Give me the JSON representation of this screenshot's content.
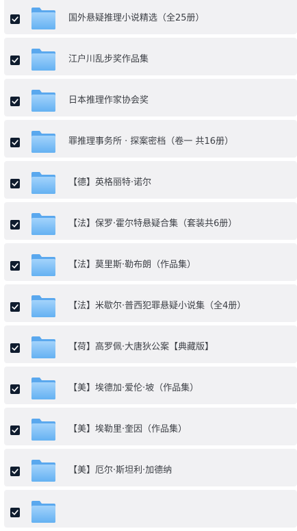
{
  "file_list": {
    "items": [
      {
        "name": "国外悬疑推理小说精选（全25册）",
        "checked": true,
        "icon": "folder-icon"
      },
      {
        "name": "江户川乱步奖作品集",
        "checked": true,
        "icon": "folder-icon"
      },
      {
        "name": "日本推理作家协会奖",
        "checked": true,
        "icon": "folder-icon"
      },
      {
        "name": "罪推理事务所 · 探案密档（卷一 共16册）",
        "checked": true,
        "icon": "folder-icon"
      },
      {
        "name": "【德】英格丽特·诺尔",
        "checked": true,
        "icon": "folder-icon"
      },
      {
        "name": "【法】保罗·霍尔特悬疑合集（套装共6册）",
        "checked": true,
        "icon": "folder-icon"
      },
      {
        "name": "【法】莫里斯·勒布朗（作品集）",
        "checked": true,
        "icon": "folder-icon"
      },
      {
        "name": "【法】米歇尔·普西犯罪悬疑小说集（全4册）",
        "checked": true,
        "icon": "folder-icon"
      },
      {
        "name": "【荷】高罗佩·大唐狄公案【典藏版】",
        "checked": true,
        "icon": "folder-icon"
      },
      {
        "name": "【美】埃德加·爱伦·坡（作品集）",
        "checked": true,
        "icon": "folder-icon"
      },
      {
        "name": "【美】埃勒里·奎因（作品集）",
        "checked": true,
        "icon": "folder-icon"
      },
      {
        "name": "【美】厄尔·斯坦利·加德纳",
        "checked": true,
        "icon": "folder-icon"
      },
      {
        "name": "",
        "checked": true,
        "icon": "folder-icon"
      }
    ]
  },
  "colors": {
    "row_background": "#f1f1f3",
    "checkbox_fill": "#0f1c2e",
    "folder_top": "#a3d3fb",
    "folder_bottom": "#64b1f2",
    "text": "#3c3f45"
  }
}
